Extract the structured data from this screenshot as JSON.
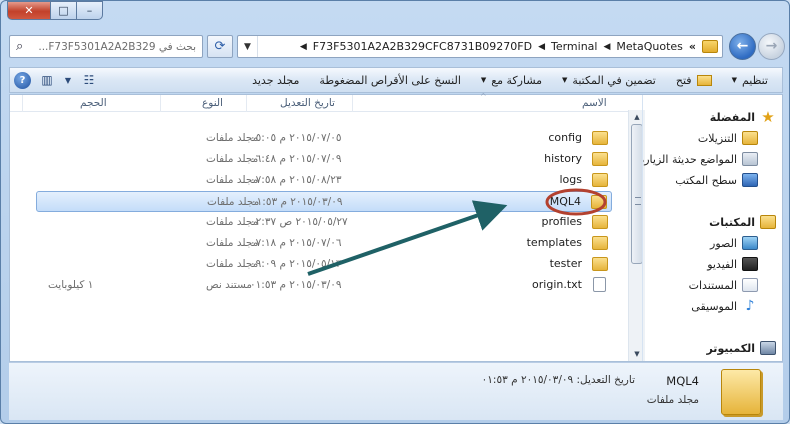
{
  "window": {
    "caption": {
      "close": "✕",
      "maximize": "□",
      "minimize": "–"
    }
  },
  "address": {
    "search_placeholder": "بحث في F73F5301A2A2B329...",
    "breadcrumbs": [
      "F73F5301A2A2B329CFC8731B09270FD",
      "Terminal",
      "MetaQuotes"
    ],
    "overflow": "«"
  },
  "toolbar": {
    "organize": "تنظيم",
    "open": "فتح",
    "include_in_library": "تضمين في المكتبة",
    "share_with": "مشاركة مع",
    "burn": "النسخ على الأقراص المضغوطة",
    "new_folder": "مجلد جديد"
  },
  "columns": {
    "name": "الاسم",
    "date_modified": "تاريخ التعديل",
    "type": "النوع",
    "size": "الحجم"
  },
  "files": [
    {
      "name": "config",
      "date": "٢٠١٥/٠٧/٠٥ م ٠٥:٠٥",
      "type": "مجلد ملفات",
      "size": "",
      "kind": "folder"
    },
    {
      "name": "history",
      "date": "٢٠١٥/٠٧/٠٩ م ٠٦:٤٨",
      "type": "مجلد ملفات",
      "size": "",
      "kind": "folder"
    },
    {
      "name": "logs",
      "date": "٢٠١٥/٠٨/٢٣ م ٠٧:٥٨",
      "type": "مجلد ملفات",
      "size": "",
      "kind": "folder"
    },
    {
      "name": "MQL4",
      "date": "٢٠١٥/٠٣/٠٩ م ٠١:٥٣",
      "type": "مجلد ملفات",
      "size": "",
      "kind": "folder",
      "selected": true
    },
    {
      "name": "profiles",
      "date": "٢٠١٥/٠٥/٢٧ ص ٠٢:٣٧",
      "type": "مجلد ملفات",
      "size": "",
      "kind": "folder"
    },
    {
      "name": "templates",
      "date": "٢٠١٥/٠٧/٠٦ م ٠٧:١٨",
      "type": "مجلد ملفات",
      "size": "",
      "kind": "folder"
    },
    {
      "name": "tester",
      "date": "٢٠١٥/٠٥/١٣ م ٠٩:٠٩",
      "type": "مجلد ملفات",
      "size": "",
      "kind": "folder"
    },
    {
      "name": "origin.txt",
      "date": "٢٠١٥/٠٣/٠٩ م ٠١:٥٣",
      "type": "مستند نص",
      "size": "١ كيلوبايت",
      "kind": "text"
    }
  ],
  "navigation": {
    "favorites": "المفضلة",
    "downloads": "التنزيلات",
    "recent_places": "المواضع حديثة الزيارة",
    "desktop": "سطح المكتب",
    "libraries": "المكتبات",
    "pictures": "الصور",
    "videos": "الفيديو",
    "documents": "المستندات",
    "music": "الموسيقى",
    "computer": "الكمبيوتر"
  },
  "details": {
    "name": "MQL4",
    "modified_label": "تاريخ التعديل:",
    "modified_value": "٢٠١٥/٠٣/٠٩ م ٠١:٥٣",
    "type": "مجلد ملفات"
  },
  "colors": {
    "selection": "#c4ddf9",
    "annotation_arrow": "#1f6166",
    "annotation_circle": "#b3412f"
  }
}
